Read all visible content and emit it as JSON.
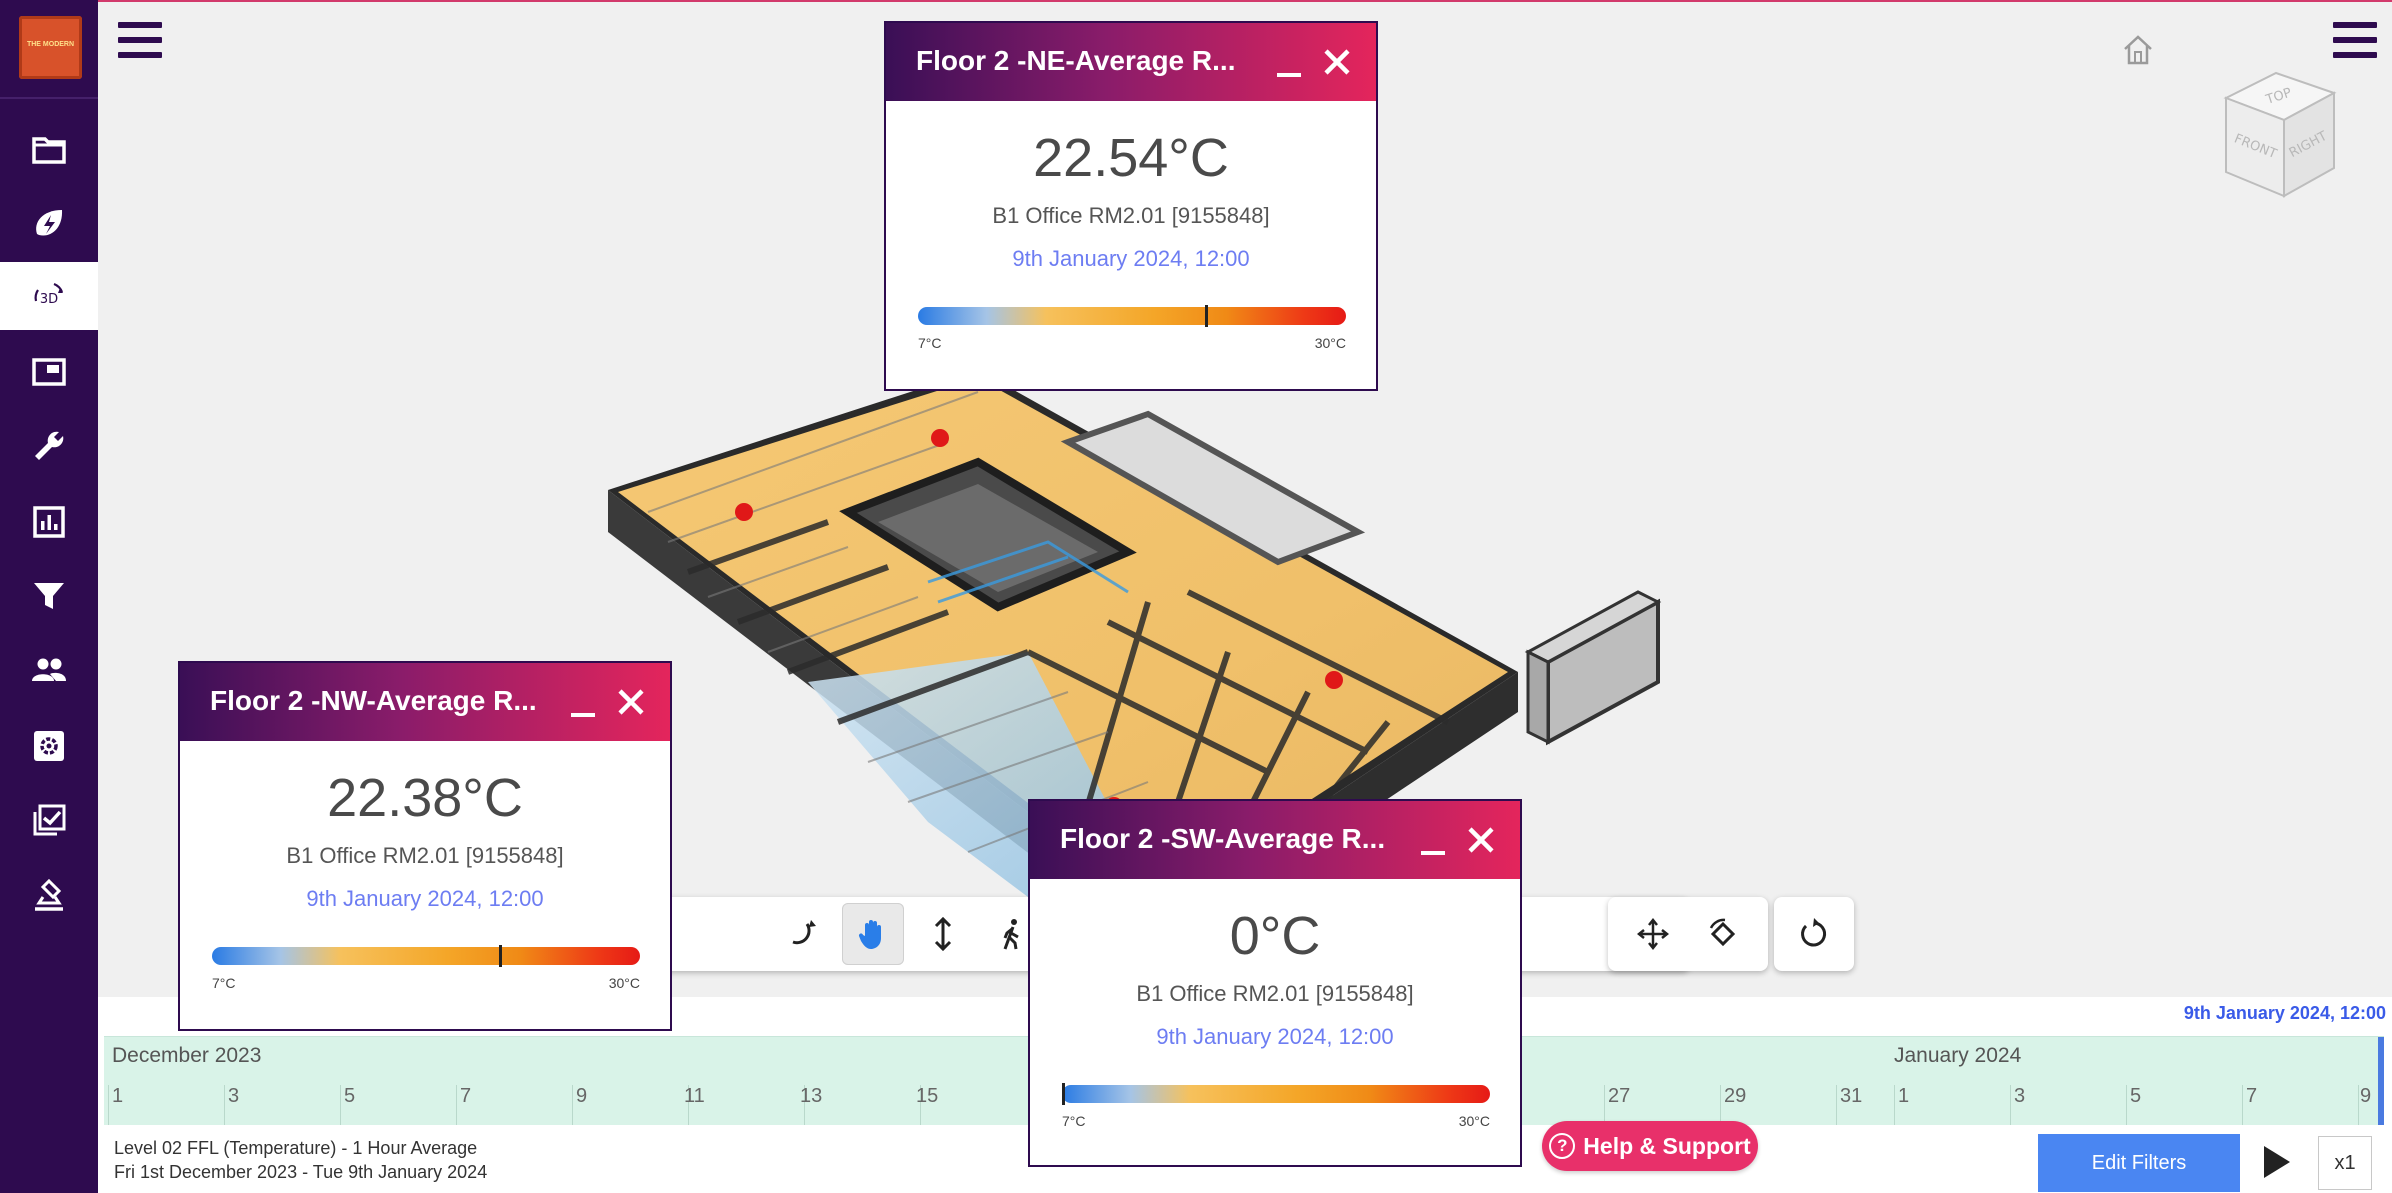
{
  "app": {
    "logo_text": "THE MODERN",
    "accent": "#2e0b4f",
    "highlight": "#e8306a"
  },
  "sidebar": {
    "items": [
      {
        "icon": "folder-icon",
        "active": false
      },
      {
        "icon": "energy-icon",
        "active": false
      },
      {
        "icon": "view-3d-icon",
        "label": "3D",
        "active": true
      },
      {
        "icon": "floorplan-icon",
        "active": false
      },
      {
        "icon": "wrench-icon",
        "active": false
      },
      {
        "icon": "report-chart-icon",
        "active": false
      },
      {
        "icon": "filter-icon",
        "active": false
      },
      {
        "icon": "users-icon",
        "active": false
      },
      {
        "icon": "settings-icon",
        "active": false
      },
      {
        "icon": "checklist-icon",
        "active": false
      },
      {
        "icon": "stamp-icon",
        "active": false
      }
    ]
  },
  "viewer": {
    "view_cube": {
      "top": "TOP",
      "front": "FRONT",
      "right": "RIGHT"
    },
    "toolbar_left": [
      {
        "icon": "orbit-icon"
      },
      {
        "icon": "pan-hand-icon",
        "active": true
      },
      {
        "icon": "zoom-vertical-icon"
      },
      {
        "icon": "walk-icon"
      },
      {
        "icon": "camera-icon"
      }
    ],
    "toolbar_right": [
      {
        "icon": "section-icon"
      },
      {
        "icon": "move-arrows-icon"
      },
      {
        "icon": "explode-icon"
      },
      {
        "icon": "reset-icon"
      }
    ]
  },
  "popups": {
    "ne": {
      "title": "Floor 2 -NE-Average R...",
      "value": "22.54°C",
      "sensor": "B1 Office RM2.01 [9155848]",
      "time": "9th January 2024, 12:00",
      "scale_min": "7°C",
      "scale_max": "30°C",
      "level": 0.67
    },
    "nw": {
      "title": "Floor 2 -NW-Average R...",
      "value": "22.38°C",
      "sensor": "B1 Office RM2.01 [9155848]",
      "time": "9th January 2024, 12:00",
      "scale_min": "7°C",
      "scale_max": "30°C",
      "level": 0.67
    },
    "sw": {
      "title": "Floor 2 -SW-Average R...",
      "value": "0°C",
      "sensor": "B1 Office RM2.01 [9155848]",
      "time": "9th January 2024, 12:00",
      "scale_min": "7°C",
      "scale_max": "30°C",
      "level": 0.0
    }
  },
  "timeline": {
    "current": "9th January 2024, 12:00",
    "months": [
      "December 2023",
      "January 2024"
    ],
    "days": [
      "1",
      "3",
      "5",
      "7",
      "9",
      "11",
      "13",
      "15",
      "27",
      "29",
      "31",
      "1",
      "3",
      "5",
      "7",
      "9"
    ]
  },
  "footer": {
    "line1": "Level 02 FFL (Temperature) - 1 Hour Average",
    "line2": "Fri 1st December 2023 - Tue 9th January 2024",
    "help_label": "Help & Support",
    "help_icon": "?",
    "edit_filters": "Edit Filters",
    "speed": "x1"
  }
}
